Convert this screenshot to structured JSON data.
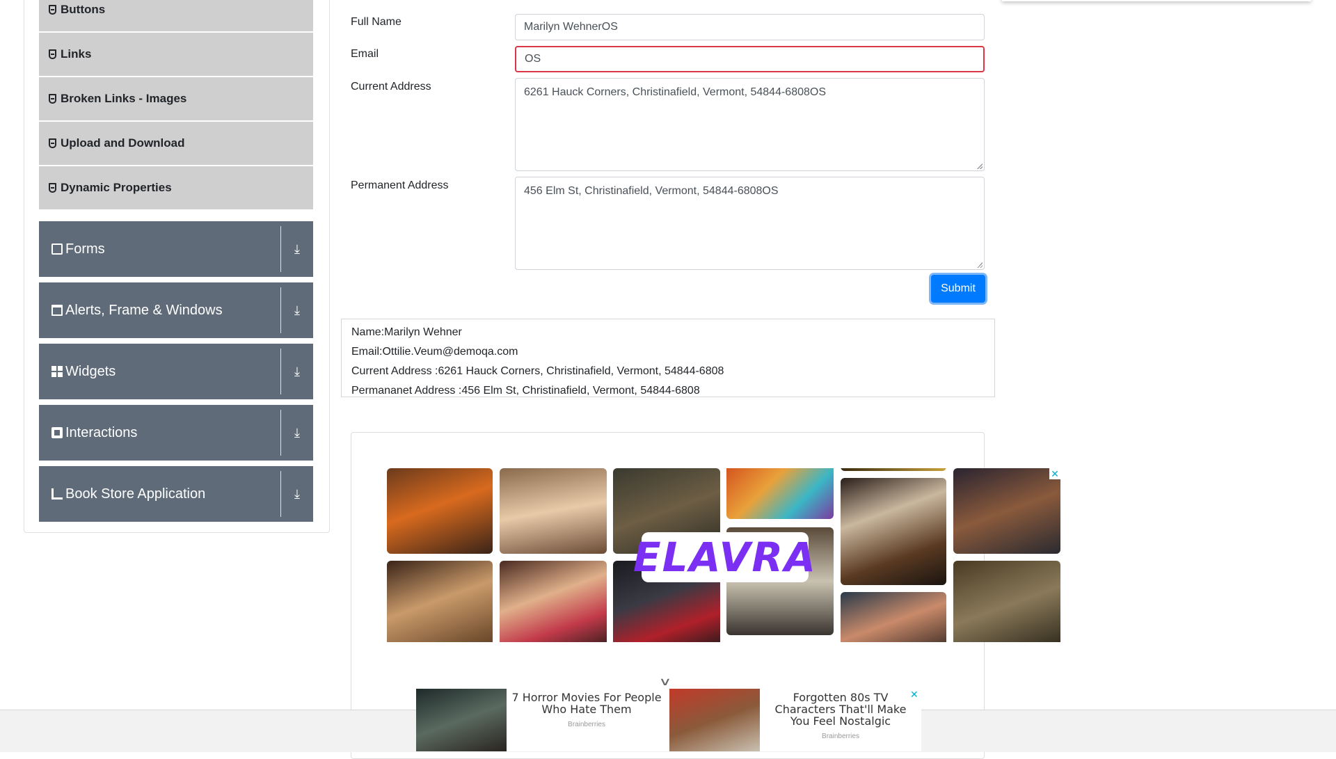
{
  "sidebar": {
    "sub_items": [
      {
        "label": "Buttons",
        "icon": "list-icon"
      },
      {
        "label": "Links",
        "icon": "list-icon"
      },
      {
        "label": "Broken Links - Images",
        "icon": "list-icon"
      },
      {
        "label": "Upload and Download",
        "icon": "list-icon"
      },
      {
        "label": "Dynamic Properties",
        "icon": "list-icon"
      }
    ],
    "groups": [
      {
        "label": "Forms",
        "icon": "forms-icon"
      },
      {
        "label": "Alerts, Frame & Windows",
        "icon": "window-icon"
      },
      {
        "label": "Widgets",
        "icon": "widgets-icon"
      },
      {
        "label": "Interactions",
        "icon": "interactions-icon"
      },
      {
        "label": "Book Store Application",
        "icon": "book-icon"
      }
    ],
    "expand_icon": "download-arrow-icon"
  },
  "form": {
    "full_name_label": "Full Name",
    "full_name_value": "Marilyn WehnerOS",
    "email_label": "Email",
    "email_value": "OS",
    "current_address_label": "Current Address",
    "current_address_value": "6261 Hauck Corners, Christinafield, Vermont, 54844-6808OS",
    "permanent_address_label": "Permanent Address",
    "permanent_address_value": "456 Elm St, Christinafield, Vermont, 54844-6808OS",
    "submit_label": "Submit",
    "email_error_color": "#dc3545",
    "submit_color": "#007bff"
  },
  "output": {
    "name": "Name:Marilyn Wehner",
    "email": "Email:Ottilie.Veum@demoqa.com",
    "current_address": "Current Address :6261 Hauck Corners, Christinafield, Vermont, 54844-6808",
    "permanent_address": "Permananet Address :456 Elm St, Christinafield, Vermont, 54844-6808"
  },
  "ad": {
    "logo_text": "ELAVRA",
    "close_symbol": "✕",
    "bottom_ads": [
      {
        "title": "7 Horror Movies For People Who Hate Them",
        "source": "Brainberries"
      },
      {
        "title": "Forgotten 80s TV Characters That'll Make You Feel Nostalgic",
        "source": "Brainberries"
      }
    ]
  },
  "colors": {
    "sidebar_group_bg": "#5f6b78",
    "sidebar_sub_bg": "#cfcfcf"
  }
}
